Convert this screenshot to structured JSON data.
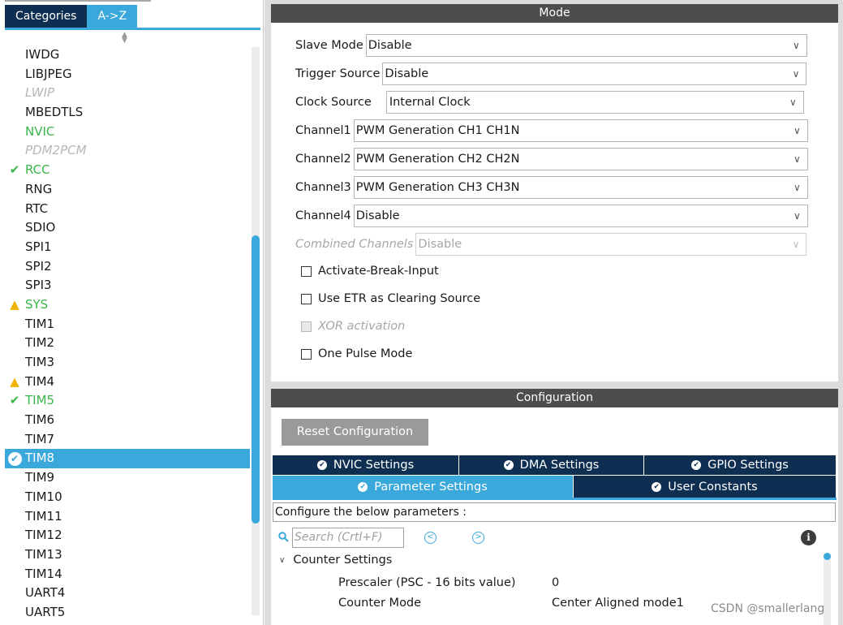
{
  "left_panel": {
    "tabs": {
      "categories": "Categories",
      "az": "A->Z"
    },
    "sort_icon": "sort-arrows-icon",
    "peripherals": [
      {
        "name": "IWDG",
        "state": "normal",
        "icon": ""
      },
      {
        "name": "LIBJPEG",
        "state": "normal",
        "icon": ""
      },
      {
        "name": "LWIP",
        "state": "disabled",
        "icon": ""
      },
      {
        "name": "MBEDTLS",
        "state": "normal",
        "icon": ""
      },
      {
        "name": "NVIC",
        "state": "green",
        "icon": ""
      },
      {
        "name": "PDM2PCM",
        "state": "disabled",
        "icon": ""
      },
      {
        "name": "RCC",
        "state": "green",
        "icon": "check"
      },
      {
        "name": "RNG",
        "state": "normal",
        "icon": ""
      },
      {
        "name": "RTC",
        "state": "normal",
        "icon": ""
      },
      {
        "name": "SDIO",
        "state": "normal",
        "icon": ""
      },
      {
        "name": "SPI1",
        "state": "normal",
        "icon": ""
      },
      {
        "name": "SPI2",
        "state": "normal",
        "icon": ""
      },
      {
        "name": "SPI3",
        "state": "normal",
        "icon": ""
      },
      {
        "name": "SYS",
        "state": "green",
        "icon": "warning"
      },
      {
        "name": "TIM1",
        "state": "normal",
        "icon": ""
      },
      {
        "name": "TIM2",
        "state": "normal",
        "icon": ""
      },
      {
        "name": "TIM3",
        "state": "normal",
        "icon": ""
      },
      {
        "name": "TIM4",
        "state": "normal",
        "icon": "warning"
      },
      {
        "name": "TIM5",
        "state": "green",
        "icon": "check"
      },
      {
        "name": "TIM6",
        "state": "normal",
        "icon": ""
      },
      {
        "name": "TIM7",
        "state": "normal",
        "icon": ""
      },
      {
        "name": "TIM8",
        "state": "selected",
        "icon": "check-circle"
      },
      {
        "name": "TIM9",
        "state": "normal",
        "icon": ""
      },
      {
        "name": "TIM10",
        "state": "normal",
        "icon": ""
      },
      {
        "name": "TIM11",
        "state": "normal",
        "icon": ""
      },
      {
        "name": "TIM12",
        "state": "normal",
        "icon": ""
      },
      {
        "name": "TIM13",
        "state": "normal",
        "icon": ""
      },
      {
        "name": "TIM14",
        "state": "normal",
        "icon": ""
      },
      {
        "name": "UART4",
        "state": "normal",
        "icon": ""
      },
      {
        "name": "UART5",
        "state": "normal",
        "icon": ""
      }
    ]
  },
  "mode": {
    "header": "Mode",
    "slave_mode": {
      "label": "Slave Mode",
      "value": "Disable"
    },
    "trigger_source": {
      "label": "Trigger Source",
      "value": "Disable"
    },
    "clock_source": {
      "label": "Clock Source",
      "value": "Internal Clock"
    },
    "channel1": {
      "label": "Channel1",
      "value": "PWM Generation CH1 CH1N"
    },
    "channel2": {
      "label": "Channel2",
      "value": "PWM Generation CH2 CH2N"
    },
    "channel3": {
      "label": "Channel3",
      "value": "PWM Generation CH3 CH3N"
    },
    "channel4": {
      "label": "Channel4",
      "value": "Disable"
    },
    "combined_channels": {
      "label": "Combined Channels",
      "value": "Disable"
    },
    "checkboxes": {
      "activate_break": "Activate-Break-Input",
      "use_etr": "Use ETR as Clearing Source",
      "xor": "XOR activation",
      "one_pulse": "One Pulse Mode"
    }
  },
  "configuration": {
    "header": "Configuration",
    "reset_button": "Reset Configuration",
    "tabs": {
      "nvic": "NVIC Settings",
      "dma": "DMA Settings",
      "gpio": "GPIO Settings",
      "parameter": "Parameter Settings",
      "user_constants": "User Constants"
    },
    "description": "Configure the below parameters :",
    "search_placeholder": "Search (Crtl+F)",
    "prev_glyph": "<",
    "next_glyph": ">",
    "info_glyph": "i",
    "counter_settings": {
      "label": "Counter Settings",
      "params": [
        {
          "name": "Prescaler (PSC - 16 bits value)",
          "value": "0"
        },
        {
          "name": "Counter Mode",
          "value": "Center Aligned mode1"
        }
      ]
    }
  },
  "watermark": "CSDN @smallerlang",
  "colors": {
    "navy": "#0f2f52",
    "accent_blue": "#3ba8dc",
    "ok_green": "#3ab54a",
    "warning_yellow": "#f0b400",
    "header_gray": "#4d4d4d"
  }
}
